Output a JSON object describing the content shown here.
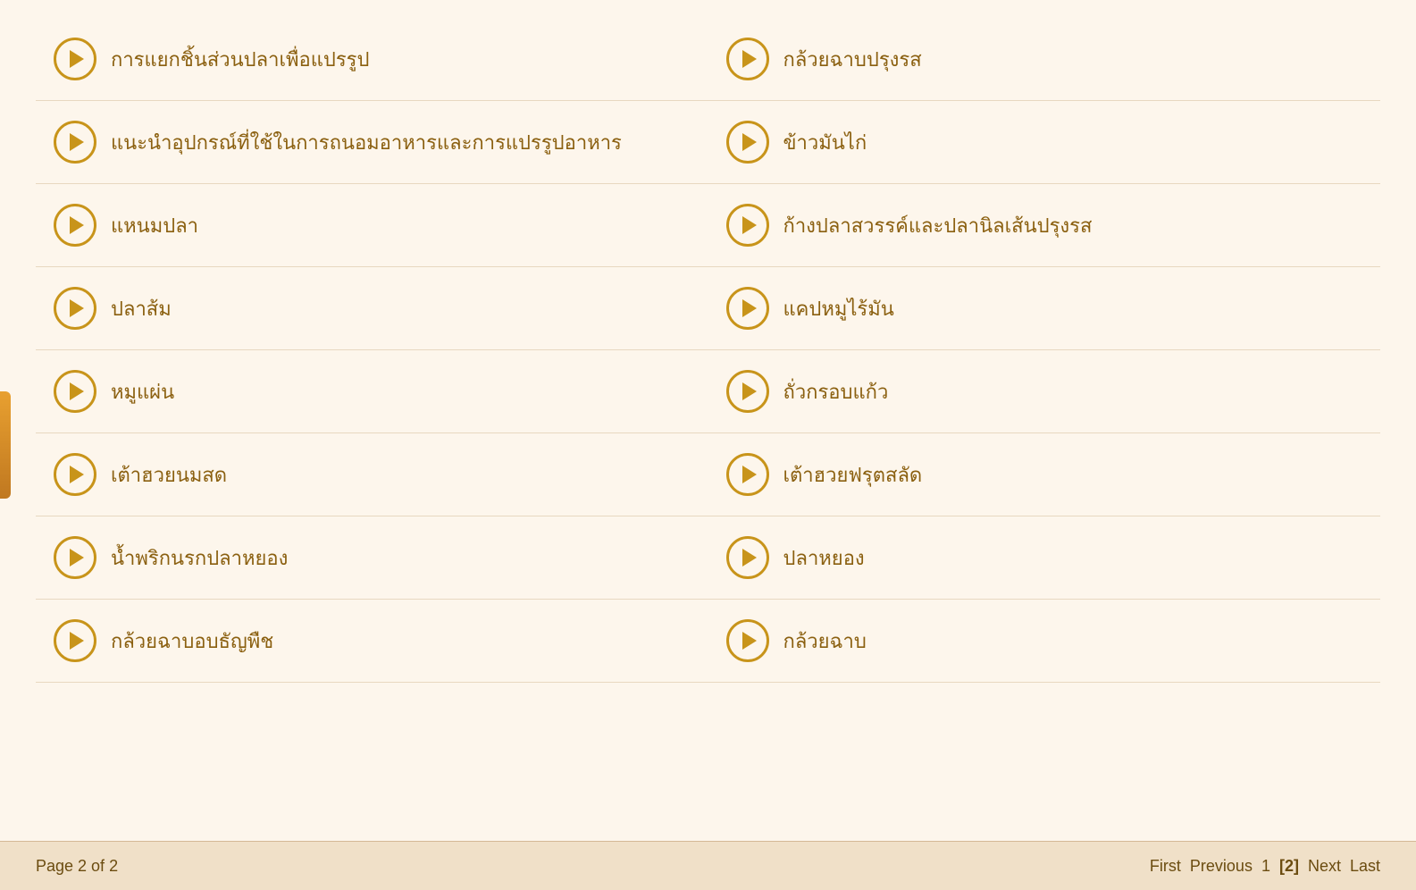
{
  "page": {
    "current": 2,
    "total": 2,
    "info": "Page 2 of 2"
  },
  "pagination": {
    "first": "First",
    "previous": "Previous",
    "page1": "1",
    "page2Current": "[2]",
    "next": "Next",
    "last": "Last"
  },
  "items": [
    {
      "id": "item-1-left",
      "label": "การแยกชิ้นส่วนปลาเพื่อแปรรูป",
      "column": "left"
    },
    {
      "id": "item-1-right",
      "label": "กล้วยฉาบปรุงรส",
      "column": "right"
    },
    {
      "id": "item-2-left",
      "label": "แนะนำอุปกรณ์ที่ใช้ในการถนอมอาหารและการแปรรูปอาหาร",
      "column": "left"
    },
    {
      "id": "item-2-right",
      "label": "ข้าวมันไก่",
      "column": "right"
    },
    {
      "id": "item-3-left",
      "label": "แหนมปลา",
      "column": "left"
    },
    {
      "id": "item-3-right",
      "label": "ก้างปลาสวรรค์และปลานิลเส้นปรุงรส",
      "column": "right"
    },
    {
      "id": "item-4-left",
      "label": "ปลาส้ม",
      "column": "left"
    },
    {
      "id": "item-4-right",
      "label": "แคปหมูไร้มัน",
      "column": "right"
    },
    {
      "id": "item-5-left",
      "label": "หมูแผ่น",
      "column": "left"
    },
    {
      "id": "item-5-right",
      "label": "ถั่วกรอบแก้ว",
      "column": "right"
    },
    {
      "id": "item-6-left",
      "label": "เต้าฮวยนมสด",
      "column": "left"
    },
    {
      "id": "item-6-right",
      "label": "เต้าฮวยฟรุตสลัด",
      "column": "right"
    },
    {
      "id": "item-7-left",
      "label": "น้ำพริกนรกปลาหยอง",
      "column": "left"
    },
    {
      "id": "item-7-right",
      "label": "ปลาหยอง",
      "column": "right"
    },
    {
      "id": "item-8-left",
      "label": "กล้วยฉาบอบธัญพืช",
      "column": "left"
    },
    {
      "id": "item-8-right",
      "label": "กล้วยฉาบ",
      "column": "right"
    }
  ]
}
